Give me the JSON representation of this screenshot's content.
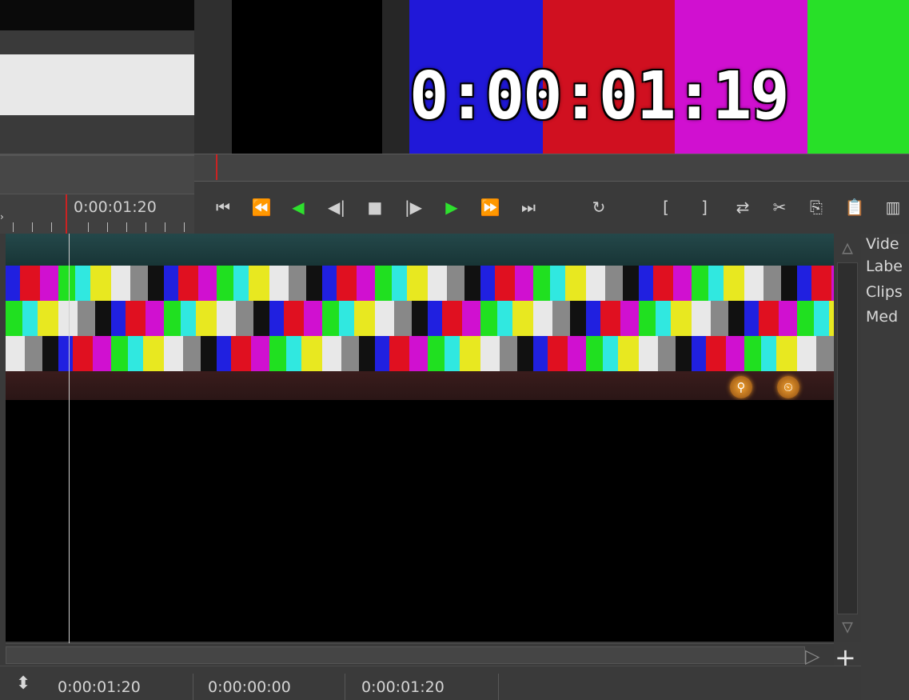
{
  "viewer": {
    "timecode_overlay": "0:00:01:19",
    "color_bars": [
      "#2018d8",
      "#d01020",
      "#d010d0",
      "#28e028"
    ]
  },
  "ruler": {
    "time": "0:00:01:20"
  },
  "transport": {
    "buttons": [
      {
        "name": "go-to-start-icon",
        "glyph": "⏮"
      },
      {
        "name": "rewind-fast-icon",
        "glyph": "⏪"
      },
      {
        "name": "play-reverse-icon",
        "glyph": "◀"
      },
      {
        "name": "step-back-icon",
        "glyph": "◀|"
      },
      {
        "name": "stop-icon",
        "glyph": "■"
      },
      {
        "name": "step-forward-icon",
        "glyph": "|▶"
      },
      {
        "name": "play-icon",
        "glyph": "▶"
      },
      {
        "name": "fast-forward-icon",
        "glyph": "⏩"
      },
      {
        "name": "go-to-end-icon",
        "glyph": "⏭"
      },
      {
        "name": "loop-icon",
        "glyph": "↻"
      },
      {
        "name": "mark-in-icon",
        "glyph": "["
      },
      {
        "name": "mark-out-icon",
        "glyph": "]"
      },
      {
        "name": "swap-icon",
        "glyph": "⇄"
      },
      {
        "name": "cut-icon",
        "glyph": "✂"
      },
      {
        "name": "copy-icon",
        "glyph": "⎘"
      },
      {
        "name": "paste-icon",
        "glyph": "📋"
      },
      {
        "name": "audio-levels-icon",
        "glyph": "▥"
      }
    ]
  },
  "right_panel": {
    "labels": [
      "Vide",
      "Labe",
      "Clips",
      "Med"
    ]
  },
  "statusbar": {
    "field1": "0:00:01:20",
    "field2": "0:00:00:00",
    "field3": "0:00:01:20"
  },
  "colors": {
    "accent_green": "#2ee02e",
    "playhead_red": "#cc2222",
    "track_header": "#24484a",
    "orange_icon": "#f0a030"
  }
}
